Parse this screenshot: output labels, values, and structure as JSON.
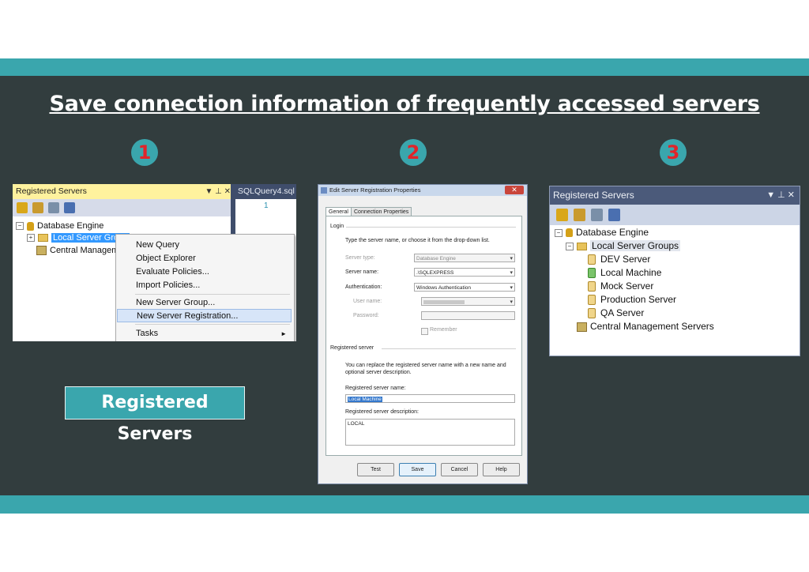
{
  "slide": {
    "title": "Save connection information of frequently accessed servers",
    "steps": [
      "1",
      "2",
      "3"
    ],
    "label": "Registered Servers"
  },
  "panel1": {
    "header": "Registered Servers",
    "header_controls": "▼ ⊥ ✕",
    "editor_tab": "SQLQuery4.sql -",
    "editor_line": "1",
    "tree": {
      "root": "Database Engine",
      "group": "Local Server Group",
      "cms": "Central Manageme"
    },
    "context_menu": [
      "New Query",
      "Object Explorer",
      "Evaluate Policies...",
      "Import Policies...",
      "New Server Group...",
      "New Server Registration...",
      "Tasks"
    ]
  },
  "panel2": {
    "title": "Edit Server Registration Properties",
    "close": "✕",
    "tabs": [
      "General",
      "Connection Properties"
    ],
    "login_section": "Login",
    "login_help": "Type the server name, or choose it from the drop-down list.",
    "server_type_label": "Server type:",
    "server_type_value": "Database Engine",
    "server_name_label": "Server name:",
    "server_name_value": ".\\SQLEXPRESS",
    "auth_label": "Authentication:",
    "auth_value": "Windows Authentication",
    "user_label": "User name:",
    "password_label": "Password:",
    "remember_label": "Remember",
    "registered_section": "Registered server",
    "registered_help_1": "You can replace the registered server name with a new name and",
    "registered_help_2": "optional server description.",
    "reg_name_label": "Registered server name:",
    "reg_name_value": "Local Machine",
    "reg_desc_label": "Registered server description:",
    "reg_desc_value": "LOCAL",
    "buttons": [
      "Test",
      "Save",
      "Cancel",
      "Help"
    ]
  },
  "panel3": {
    "header": "Registered Servers",
    "header_controls": "▼ ⊥ ✕",
    "tree": {
      "root": "Database Engine",
      "group": "Local Server Groups",
      "servers": [
        "DEV Server",
        "Local Machine",
        "Mock Server",
        "Production Server",
        "QA Server"
      ],
      "cms": "Central Management Servers"
    }
  },
  "colors": {
    "teal": "#3aa6ad",
    "dark": "#323d3e",
    "step_number": "#e0242a"
  }
}
